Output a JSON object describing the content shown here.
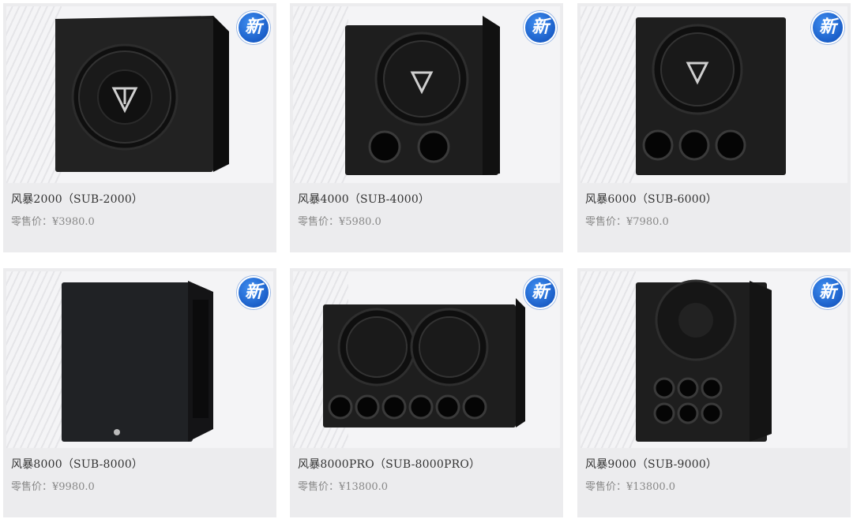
{
  "products": [
    {
      "name": "风暴2000（SUB-2000）",
      "price": "零售价：¥3980.0",
      "badge": "新",
      "badge_color": "#1b5fc9",
      "image": "subwoofer-single-driver"
    },
    {
      "name": "风暴4000（SUB-4000）",
      "price": "零售价：¥5980.0",
      "badge": "新",
      "badge_color": "#1b5fc9",
      "image": "subwoofer-driver-two-ports"
    },
    {
      "name": "风暴6000（SUB-6000）",
      "price": "零售价：¥7980.0",
      "badge": "新",
      "badge_color": "#1b5fc9",
      "image": "subwoofer-driver-three-ports"
    },
    {
      "name": "风暴8000（SUB-8000）",
      "price": "零售价：¥9980.0",
      "badge": "新",
      "badge_color": "#1b5fc9",
      "image": "subwoofer-grille-cube"
    },
    {
      "name": "风暴8000PRO（SUB-8000PRO）",
      "price": "零售价：¥13800.0",
      "badge": "新",
      "badge_color": "#1b5fc9",
      "image": "subwoofer-dual-driver-six-ports"
    },
    {
      "name": "风暴9000（SUB-9000）",
      "price": "零售价：¥13800.0",
      "badge": "新",
      "badge_color": "#1b5fc9",
      "image": "subwoofer-horn-six-ports"
    }
  ]
}
